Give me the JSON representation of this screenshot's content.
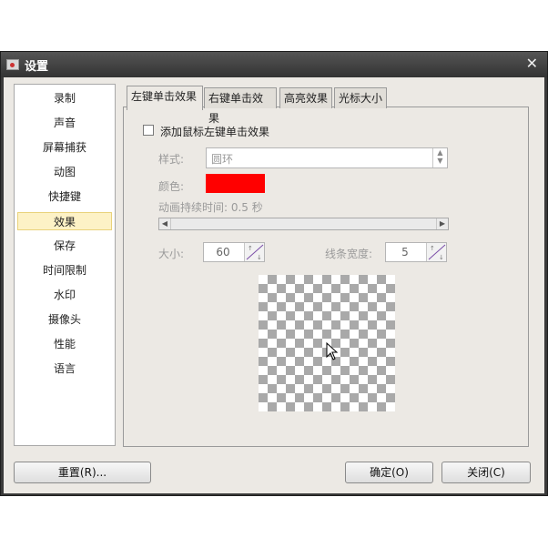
{
  "window": {
    "title": "设置"
  },
  "sidebar": {
    "items": [
      {
        "label": "录制"
      },
      {
        "label": "声音"
      },
      {
        "label": "屏幕捕获"
      },
      {
        "label": "动图"
      },
      {
        "label": "快捷键"
      },
      {
        "label": "效果"
      },
      {
        "label": "保存"
      },
      {
        "label": "时间限制"
      },
      {
        "label": "水印"
      },
      {
        "label": "摄像头"
      },
      {
        "label": "性能"
      },
      {
        "label": "语言"
      }
    ],
    "active": "效果"
  },
  "tabs": [
    {
      "label": "左键单击效果"
    },
    {
      "label": "右键单击效果"
    },
    {
      "label": "高亮效果"
    },
    {
      "label": "光标大小"
    }
  ],
  "effects": {
    "enable_label": "添加鼠标左键单击效果",
    "style_label": "样式:",
    "style_value": "圆环",
    "color_label": "颜色:",
    "color_value": "#ff0000",
    "duration_label": "动画持续时间: 0.5 秒",
    "size_label": "大小:",
    "size_value": "60",
    "line_width_label": "线条宽度:",
    "line_width_value": "5"
  },
  "footer": {
    "reset_label": "重置(R)...",
    "ok_label": "确定(O)",
    "close_label": "关闭(C)"
  },
  "colors": {
    "titlebar": "#3a3a3a",
    "active_item": "#fdf2c6",
    "swatch": "#ff0000"
  }
}
